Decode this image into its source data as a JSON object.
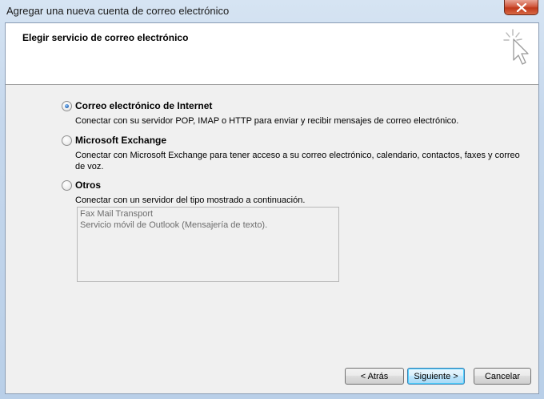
{
  "window": {
    "title": "Agregar una nueva cuenta de correo electrónico"
  },
  "header": {
    "title": "Elegir servicio de correo electrónico",
    "icon": "wizard-cursor-icon"
  },
  "options": [
    {
      "label": "Correo electrónico de Internet",
      "description": "Conectar con su servidor POP, IMAP o HTTP para enviar y recibir mensajes de correo electrónico.",
      "selected": true
    },
    {
      "label": "Microsoft Exchange",
      "description_line1": "Conectar con Microsoft Exchange para tener acceso a su correo electrónico, calendario, contactos, faxes y correo",
      "description_line2": "de voz.",
      "selected": false
    },
    {
      "label": "Otros",
      "description": "Conectar con un servidor del tipo mostrado a continuación.",
      "selected": false
    }
  ],
  "other_servers": [
    "Fax Mail Transport",
    "Servicio móvil de Outlook (Mensajería de texto)."
  ],
  "buttons": {
    "back": "< Atrás",
    "next": "Siguiente >",
    "cancel": "Cancelar"
  },
  "colors": {
    "accent": "#2f6fbd",
    "close_button": "#c0381b"
  }
}
